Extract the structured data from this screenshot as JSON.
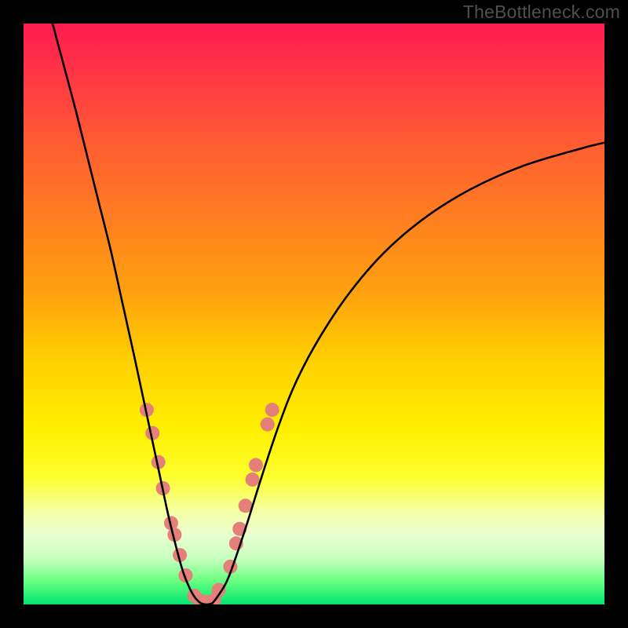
{
  "watermark": "TheBottleneck.com",
  "colors": {
    "page_bg": "#000000",
    "curve_stroke": "#000000",
    "dot_fill": "#e48079",
    "gradient_top": "#ff1b4f",
    "gradient_bottom": "#00e56e"
  },
  "chart_data": {
    "type": "line",
    "title": "",
    "xlabel": "",
    "ylabel": "",
    "xlim": [
      0,
      100
    ],
    "ylim": [
      0,
      100
    ],
    "grid": false,
    "series": [
      {
        "name": "left-curve",
        "x": [
          5,
          7,
          9,
          11,
          13,
          15,
          17,
          19,
          20.5,
          22,
          23.5,
          25,
          26.5,
          27.5,
          28.5,
          29.5,
          30.5
        ],
        "y": [
          100,
          92.5,
          85,
          77,
          69,
          61,
          52,
          43,
          36,
          29,
          22,
          15,
          9,
          5.5,
          3,
          1.2,
          0.2
        ]
      },
      {
        "name": "right-curve",
        "x": [
          32.5,
          33.5,
          35,
          36.5,
          38.5,
          41,
          44,
          47,
          51,
          56,
          62,
          69,
          77,
          86,
          96,
          100
        ],
        "y": [
          0.2,
          1.5,
          4,
          8,
          14,
          22,
          31,
          38.5,
          46,
          53.5,
          60.5,
          66.5,
          71.5,
          75.5,
          78.5,
          79.5
        ]
      },
      {
        "name": "bottom-connector",
        "x": [
          30.5,
          31,
          31.5,
          32,
          32.5
        ],
        "y": [
          0.2,
          0.05,
          0,
          0.05,
          0.2
        ]
      }
    ],
    "scatter_points": {
      "name": "highlighted-dots",
      "color": "#e48079",
      "radius": 9,
      "points": [
        {
          "x": 21.2,
          "y": 33.5
        },
        {
          "x": 22.2,
          "y": 29.5
        },
        {
          "x": 23.2,
          "y": 24.5
        },
        {
          "x": 24.0,
          "y": 20.0
        },
        {
          "x": 25.4,
          "y": 14.0
        },
        {
          "x": 26.0,
          "y": 12.0
        },
        {
          "x": 26.9,
          "y": 8.5
        },
        {
          "x": 27.9,
          "y": 5.0
        },
        {
          "x": 29.4,
          "y": 1.5
        },
        {
          "x": 30.4,
          "y": 0.6
        },
        {
          "x": 31.2,
          "y": 0.4
        },
        {
          "x": 32.0,
          "y": 0.4
        },
        {
          "x": 32.8,
          "y": 0.8
        },
        {
          "x": 33.6,
          "y": 2.5
        },
        {
          "x": 35.6,
          "y": 6.5
        },
        {
          "x": 36.6,
          "y": 10.5
        },
        {
          "x": 37.2,
          "y": 13.0
        },
        {
          "x": 38.2,
          "y": 17.0
        },
        {
          "x": 39.4,
          "y": 21.5
        },
        {
          "x": 40.0,
          "y": 24.0
        },
        {
          "x": 42.0,
          "y": 31.0
        },
        {
          "x": 42.8,
          "y": 33.5
        }
      ]
    }
  }
}
